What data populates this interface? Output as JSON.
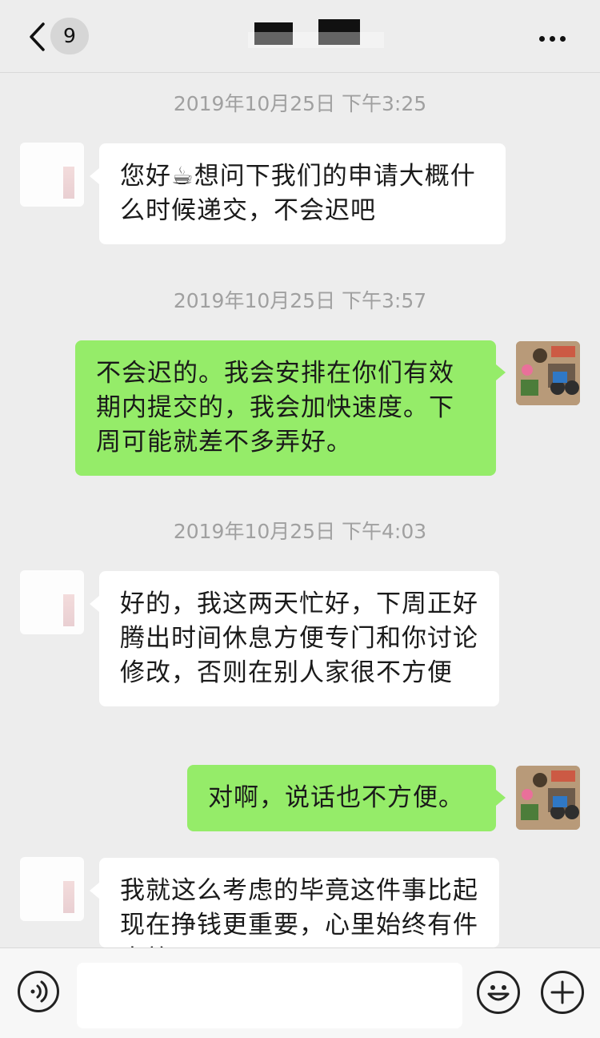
{
  "header": {
    "unread_count": "9",
    "back_icon": "chevron-left-icon",
    "more_icon": "ellipsis-icon"
  },
  "messages": [
    {
      "timestamp": "2019年10月25日 下午3:25"
    },
    {
      "side": "left",
      "text": "您好☕想问下我们的申请大概什么时候递交，不会迟吧"
    },
    {
      "timestamp": "2019年10月25日 下午3:57"
    },
    {
      "side": "right",
      "text": "不会迟的。我会安排在你们有效期内提交的，我会加快速度。下周可能就差不多弄好。"
    },
    {
      "timestamp": "2019年10月25日 下午4:03"
    },
    {
      "side": "left",
      "text": "好的，我这两天忙好，下周正好腾出时间休息方便专门和你讨论修改，否则在别人家很不方便"
    },
    {
      "side": "right",
      "text": "对啊，说话也不方便。"
    },
    {
      "side": "left",
      "text": "我就这么考虑的毕竟这件事比起现在挣钱更重要，心里始终有件事放不下"
    }
  ],
  "input_bar": {
    "voice_icon": "voice-icon",
    "emoji_icon": "emoji-icon",
    "plus_icon": "plus-icon",
    "text_value": ""
  },
  "colors": {
    "background": "#ededed",
    "sent_bubble": "#95ec69",
    "received_bubble": "#ffffff",
    "timestamp": "#a0a0a0"
  }
}
